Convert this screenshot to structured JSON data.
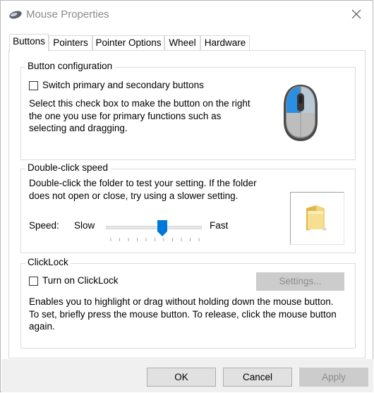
{
  "window": {
    "title": "Mouse Properties",
    "icon": "mouse-icon"
  },
  "tabs": [
    {
      "label": "Buttons",
      "active": true
    },
    {
      "label": "Pointers",
      "active": false
    },
    {
      "label": "Pointer Options",
      "active": false
    },
    {
      "label": "Wheel",
      "active": false
    },
    {
      "label": "Hardware",
      "active": false
    }
  ],
  "button_config": {
    "title": "Button configuration",
    "switch_label": "Switch primary and secondary buttons",
    "switch_checked": false,
    "description_lines": [
      "Select this check box to make the button on the right",
      "the one you use for primary functions such as",
      "selecting and dragging."
    ]
  },
  "double_click": {
    "title": "Double-click speed",
    "description_lines": [
      "Double-click the folder to test your setting. If the folder",
      "does not open or close, try using a slower setting."
    ],
    "speed_label": "Speed:",
    "slow_label": "Slow",
    "fast_label": "Fast",
    "slider_level": 0.6
  },
  "clicklock": {
    "title": "ClickLock",
    "toggle_label": "Turn on ClickLock",
    "toggle_checked": false,
    "settings_label": "Settings...",
    "description_lines": [
      "Enables you to highlight or drag without holding down the mouse button.",
      "To set, briefly press the mouse button. To release, click the mouse button",
      "again."
    ]
  },
  "footer": {
    "ok_label": "OK",
    "cancel_label": "Cancel",
    "apply_label": "Apply"
  },
  "colors": {
    "accent": "#0078d7",
    "mouse_highlight": "#2a8fe0",
    "folder": "#f2d57b"
  }
}
